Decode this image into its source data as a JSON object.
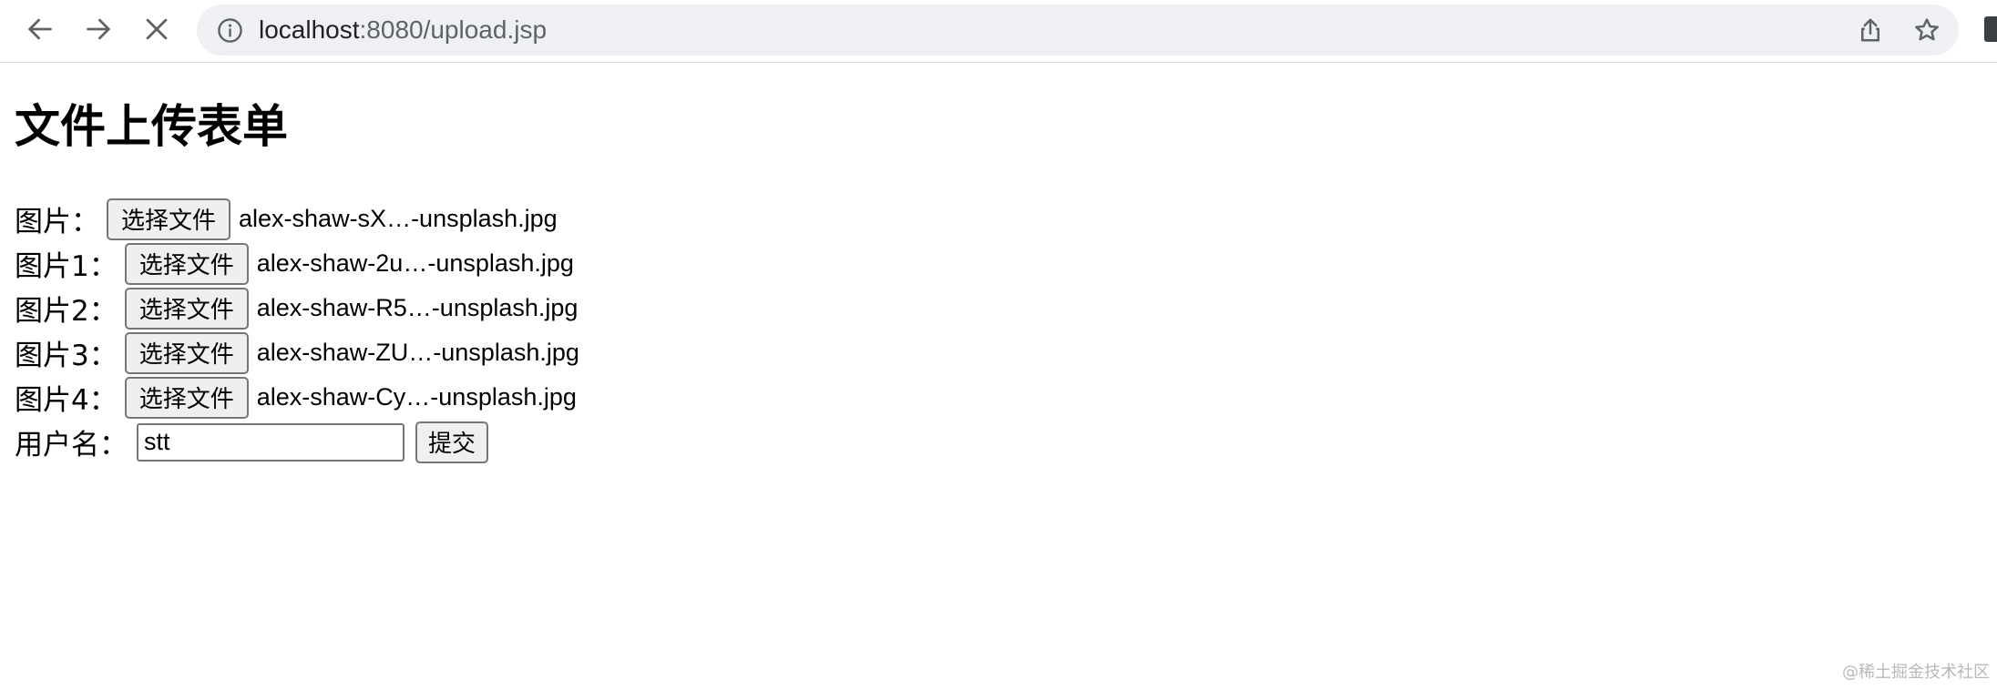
{
  "browser": {
    "url_host": "localhost",
    "url_path": ":8080/upload.jsp",
    "icons": [
      "back-arrow-icon",
      "forward-arrow-icon",
      "stop-loading-icon",
      "site-info-icon",
      "share-icon",
      "bookmark-star-icon"
    ]
  },
  "page": {
    "title": "文件上传表单",
    "file_rows": [
      {
        "label": "图片：",
        "button": "选择文件",
        "filename": "alex-shaw-sX…-unsplash.jpg"
      },
      {
        "label": "图片1：",
        "button": "选择文件",
        "filename": "alex-shaw-2u…-unsplash.jpg"
      },
      {
        "label": "图片2：",
        "button": "选择文件",
        "filename": "alex-shaw-R5…-unsplash.jpg"
      },
      {
        "label": "图片3：",
        "button": "选择文件",
        "filename": "alex-shaw-ZU…-unsplash.jpg"
      },
      {
        "label": "图片4：",
        "button": "选择文件",
        "filename": "alex-shaw-Cy…-unsplash.jpg"
      }
    ],
    "username_label": "用户名：",
    "username_value": "stt",
    "submit_label": "提交"
  },
  "watermark": "@稀土掘金技术社区",
  "colors": {
    "toolbar_bg": "#ffffff",
    "omnibox_bg": "#eef0f3",
    "button_bg": "#efefef",
    "button_border": "#767676"
  }
}
